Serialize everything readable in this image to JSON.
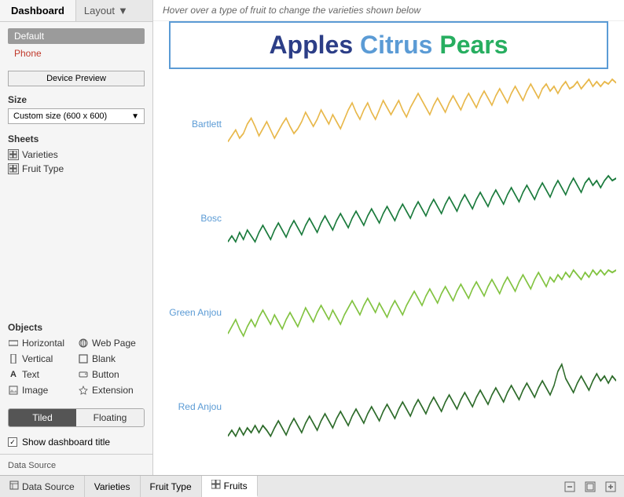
{
  "tabs": {
    "dashboard": "Dashboard",
    "layout": "Layout"
  },
  "sidebar": {
    "size_label": "Size",
    "size_value": "Custom size (600 x 600)",
    "sheets_label": "Sheets",
    "sheets": [
      {
        "name": "Varieties",
        "icon": "grid"
      },
      {
        "name": "Fruit Type",
        "icon": "grid"
      }
    ],
    "objects_label": "Objects",
    "objects_left": [
      {
        "name": "Horizontal",
        "icon": "▭"
      },
      {
        "name": "Vertical",
        "icon": "▯"
      },
      {
        "name": "Text",
        "icon": "A"
      },
      {
        "name": "Image",
        "icon": "⬜"
      }
    ],
    "objects_right": [
      {
        "name": "Web Page",
        "icon": "⊕"
      },
      {
        "name": "Blank",
        "icon": "□"
      },
      {
        "name": "Button",
        "icon": "⊡"
      },
      {
        "name": "Extension",
        "icon": "❄"
      }
    ],
    "tiled_label": "Tiled",
    "floating_label": "Floating",
    "show_dashboard_title": "Show dashboard title",
    "device_preview": "Device Preview",
    "default_label": "Default",
    "phone_label": "Phone"
  },
  "chart": {
    "hint": "Hover over a type of fruit to change the varieties shown below",
    "title_apples": "Apples",
    "title_citrus": "Citrus",
    "title_pears": "Pears",
    "rows": [
      {
        "label": "Bartlett"
      },
      {
        "label": "Bosc"
      },
      {
        "label": "Green Anjou"
      },
      {
        "label": "Red Anjou"
      }
    ]
  },
  "bottom_tabs": [
    {
      "name": "Data Source",
      "type": "datasource",
      "icon": ""
    },
    {
      "name": "Varieties",
      "type": "sheet",
      "icon": ""
    },
    {
      "name": "Fruit Type",
      "type": "sheet",
      "icon": ""
    },
    {
      "name": "Fruits",
      "type": "active",
      "icon": "⊞"
    }
  ],
  "bottom_actions": [
    "⊟",
    "⊞",
    "⊠"
  ]
}
